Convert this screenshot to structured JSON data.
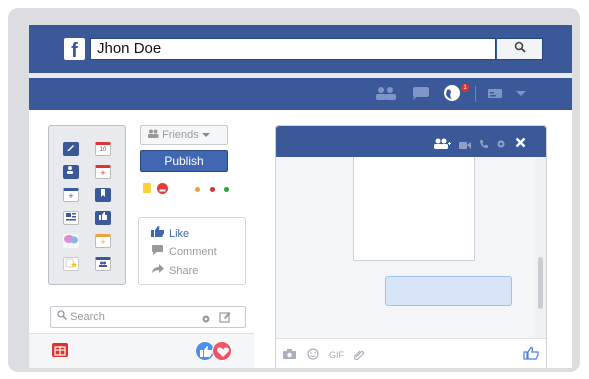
{
  "header": {
    "logo_letter": "f",
    "search_value": "Jhon Doe",
    "search_icon": "magnifier-icon",
    "notification_count": "1",
    "icons": [
      "friend-requests-icon",
      "messages-icon",
      "notifications-globe-icon",
      "account-icon",
      "dropdown-arrow-icon"
    ]
  },
  "toolbox": {
    "calendar_day": "10"
  },
  "composer": {
    "audience_label": "Friends",
    "publish_label": "Publish",
    "colors": {
      "yellow": "#f7d33a",
      "red": "#e23b3b",
      "orange": "#f0a23a",
      "dark_red": "#d43030",
      "green": "#2f9e3f"
    }
  },
  "actions": {
    "like": "Like",
    "comment": "Comment",
    "share": "Share"
  },
  "chat_search": {
    "placeholder": "Search"
  },
  "chat_window": {
    "gif_label": "GIF"
  },
  "colors": {
    "brand": "#3b5998",
    "light_bg": "#e9eaed"
  }
}
